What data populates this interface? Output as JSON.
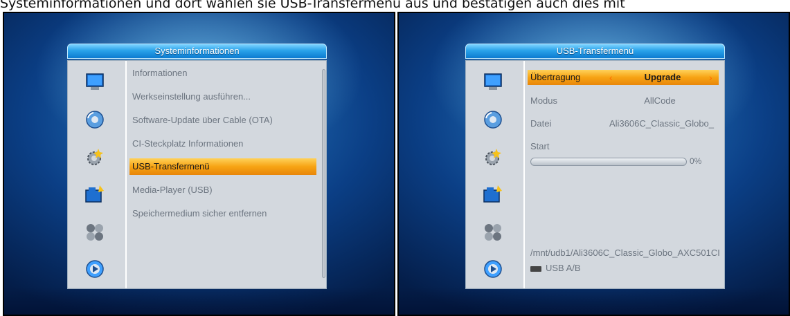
{
  "caption": "Systeminformationen und dort wählen sie USB-Transfermenü aus und bestätigen auch dies mit",
  "left_screen": {
    "title": "Systeminformationen",
    "icons": [
      "monitor-icon",
      "disc-icon",
      "gear-icon",
      "usb-folder-icon",
      "media-icon",
      "satellite-dish-icon"
    ],
    "menu_items": [
      {
        "label": "Informationen",
        "selected": false
      },
      {
        "label": "Werkseinstellung ausführen...",
        "selected": false
      },
      {
        "label": "Software-Update über Cable (OTA)",
        "selected": false
      },
      {
        "label": "CI-Steckplatz Informationen",
        "selected": false
      },
      {
        "label": "USB-Transfermenü",
        "selected": true
      },
      {
        "label": "Media-Player (USB)",
        "selected": false
      },
      {
        "label": "Speichermedium sicher entfernen",
        "selected": false
      }
    ]
  },
  "right_screen": {
    "title": "USB-Transfermenü",
    "icons": [
      "monitor-icon",
      "disc-icon",
      "gear-icon",
      "usb-folder-icon",
      "media-icon",
      "satellite-dish-icon"
    ],
    "rows": {
      "uebertragung": {
        "label": "Übertragung",
        "value": "Upgrade",
        "left_arrow": "‹",
        "right_arrow": "›"
      },
      "modus": {
        "label": "Modus",
        "value": "AllCode"
      },
      "datei": {
        "label": "Datei",
        "value": "Ali3606C_Classic_Globo_"
      },
      "start": {
        "label": "Start"
      }
    },
    "progress": {
      "value_percent": 0,
      "label": "0%"
    },
    "path": "/mnt/udb1/Ali3606C_Classic_Globo_AXC501CI",
    "usb_label": "USB A/B"
  },
  "colors": {
    "highlight": "#f7a313",
    "title_bar": "#2aa3ea",
    "panel": "#d3d8de",
    "text": "#6c7580"
  }
}
